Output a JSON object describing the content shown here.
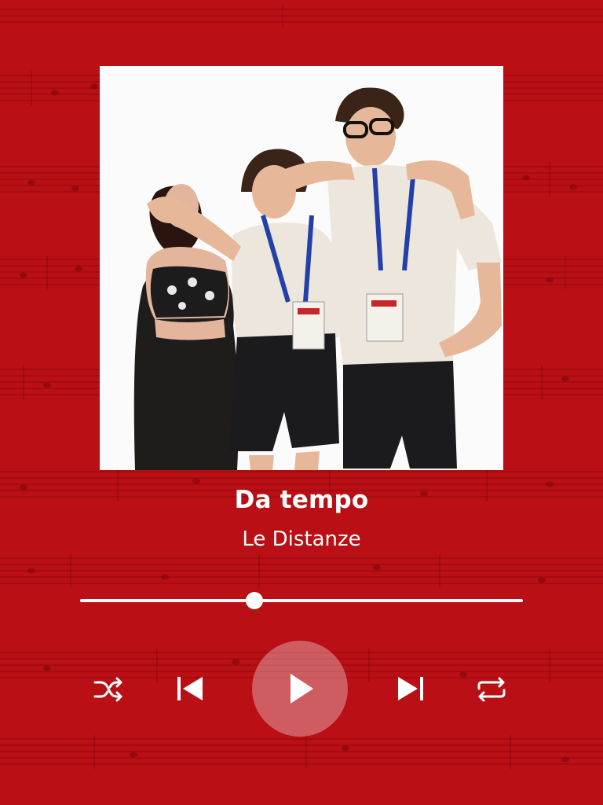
{
  "track": {
    "title": "Da tempo",
    "artist": "Le Distanze"
  },
  "playback": {
    "progress": 0.394,
    "state": "paused"
  },
  "controls": {
    "shuffle_icon": "shuffle-icon",
    "previous_icon": "skip-previous-icon",
    "play_icon": "play-icon",
    "next_icon": "skip-next-icon",
    "repeat_icon": "repeat-icon"
  },
  "colors": {
    "background": "#b90f15",
    "foreground": "#ffffff"
  }
}
